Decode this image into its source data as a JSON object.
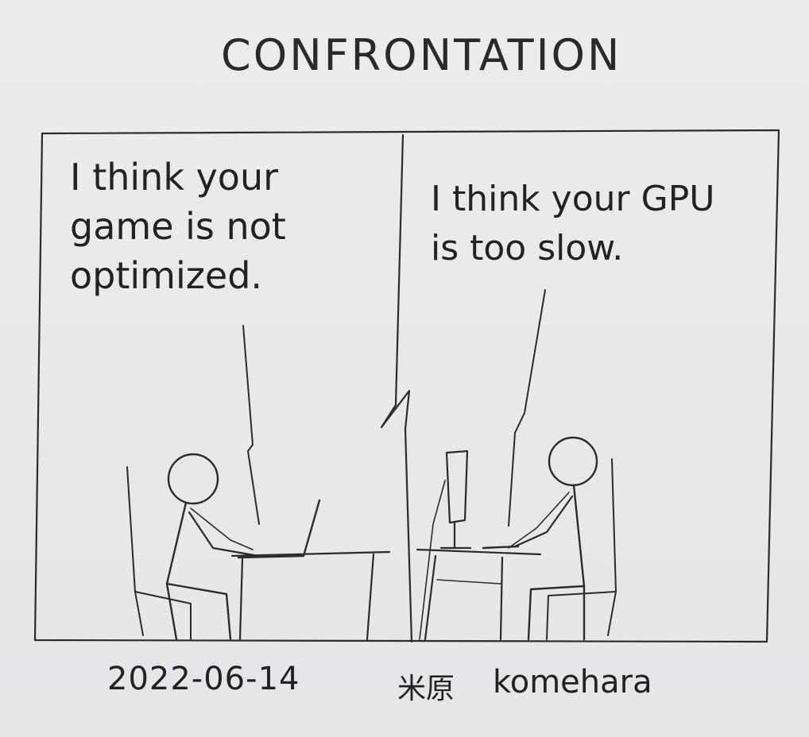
{
  "comic": {
    "title": "CONFRONTATION",
    "panel_left": {
      "speech": "I think your\ngame is not\noptimized."
    },
    "panel_right": {
      "speech": "I think your GPU\nis too slow."
    },
    "footer": {
      "date": "2022-06-14",
      "author_kanji": "米原",
      "author_name": "komehara"
    }
  },
  "colors": {
    "paper": "#e9e9eb",
    "pencil": "#2b2b2b"
  }
}
